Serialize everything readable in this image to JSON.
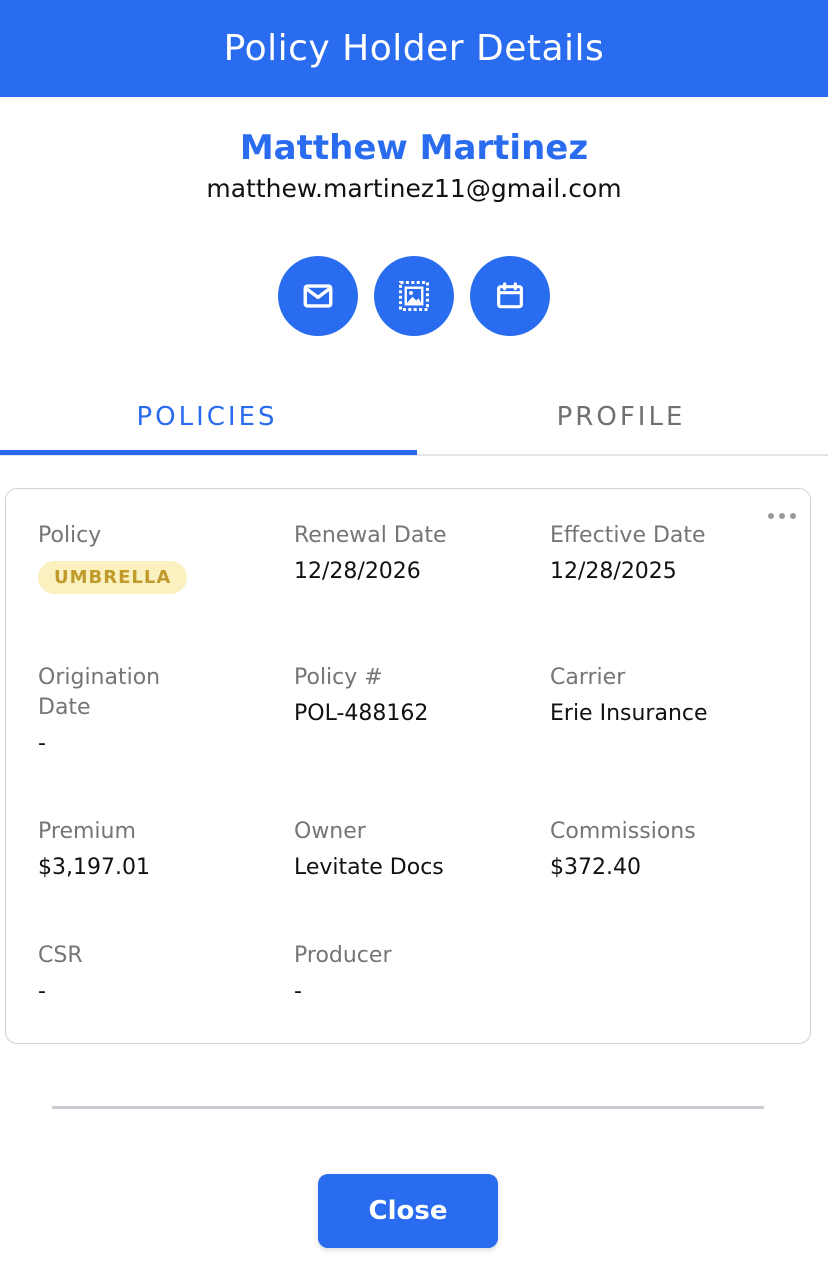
{
  "header": {
    "title": "Policy Holder Details"
  },
  "holder": {
    "name": "Matthew Martinez",
    "email": "matthew.martinez11@gmail.com"
  },
  "actions": [
    {
      "icon": "mail-icon"
    },
    {
      "icon": "image-frame-icon"
    },
    {
      "icon": "calendar-icon"
    }
  ],
  "tabs": [
    {
      "label": "POLICIES",
      "active": true
    },
    {
      "label": "PROFILE",
      "active": false
    }
  ],
  "policy": {
    "policy_label": "Policy",
    "policy_type": "UMBRELLA",
    "renewal_label": "Renewal Date",
    "renewal_value": "12/28/2026",
    "effective_label": "Effective Date",
    "effective_value": "12/28/2025",
    "origination_label": "Origination Date",
    "origination_value": "-",
    "policy_num_label": "Policy #",
    "policy_num_value": "POL-488162",
    "carrier_label": "Carrier",
    "carrier_value": "Erie Insurance",
    "premium_label": "Premium",
    "premium_value": "$3,197.01",
    "owner_label": "Owner",
    "owner_value": "Levitate Docs",
    "commissions_label": "Commissions",
    "commissions_value": "$372.40",
    "csr_label": "CSR",
    "csr_value": "-",
    "producer_label": "Producer",
    "producer_value": "-"
  },
  "footer": {
    "close_label": "Close"
  },
  "colors": {
    "accent": "#2a6cf0",
    "badge_bg": "#fbf0bf",
    "badge_text": "#c19a2c"
  }
}
